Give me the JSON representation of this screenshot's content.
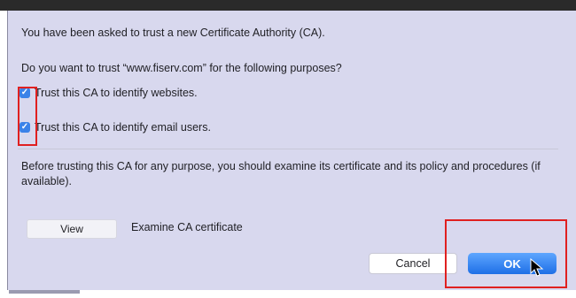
{
  "dialog": {
    "intro": "You have been asked to trust a new Certificate Authority (CA).",
    "question": "Do you want to trust “www.fiserv.com” for the following purposes?",
    "checkboxes": [
      {
        "label": "Trust this CA to identify websites.",
        "checked": true
      },
      {
        "label": "Trust this CA to identify email users.",
        "checked": true
      }
    ],
    "note": "Before trusting this CA for any purpose, you should examine its certificate and its policy and procedures (if available).",
    "view_button": "View",
    "view_description": "Examine CA certificate",
    "cancel_button": "Cancel",
    "ok_button": "OK"
  },
  "colors": {
    "dialog_bg": "#d8d8ee",
    "accent": "#1e6fe6",
    "highlight": "#e02020"
  },
  "icons": {
    "checkbox": "check-mark",
    "cursor": "mouse-pointer-icon"
  }
}
